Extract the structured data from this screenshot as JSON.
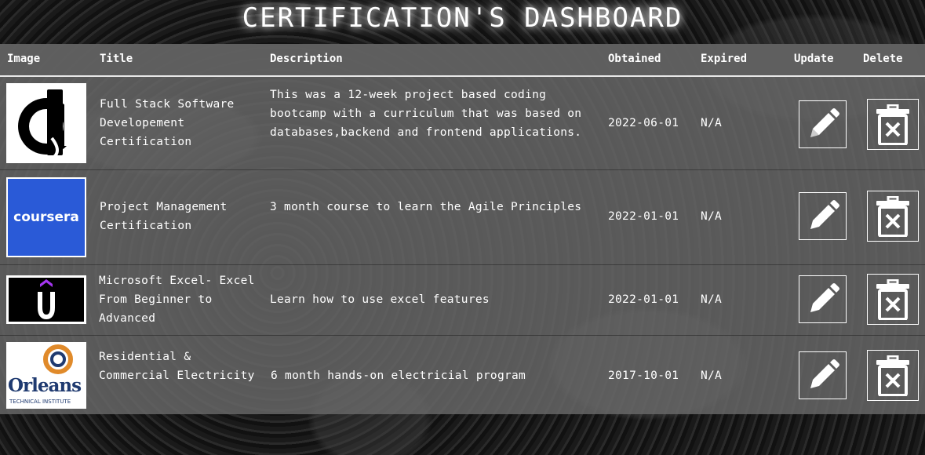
{
  "page": {
    "title": "CERTIFICATION'S DASHBOARD"
  },
  "table": {
    "headers": {
      "image": "Image",
      "title": "Title",
      "description": "Description",
      "obtained": "Obtained",
      "expired": "Expired",
      "update": "Update",
      "delete": "Delete"
    },
    "rows": [
      {
        "logo": "devmountain-logo",
        "title": "Full Stack Software Developement Certification",
        "description": "This was a 12-week project based coding bootcamp with a curriculum that was based on databases,backend and frontend applications.",
        "obtained": "2022-06-01",
        "expired": "N/A"
      },
      {
        "logo": "coursera-logo",
        "logo_text": "coursera",
        "title": "Project Management Certification",
        "description": "3 month course to learn the Agile Principles",
        "obtained": "2022-01-01",
        "expired": "N/A"
      },
      {
        "logo": "udemy-logo",
        "title": "Microsoft Excel- Excel From Beginner to Advanced",
        "description": "Learn how to use excel features",
        "obtained": "2022-01-01",
        "expired": "N/A"
      },
      {
        "logo": "orleans-logo",
        "logo_text": "Orleans",
        "logo_subtext": "TECHNICAL INSTITUTE",
        "title": "Residential & Commercial Electricity",
        "description": "6 month hands-on electricial program",
        "obtained": "2017-10-01",
        "expired": "N/A"
      }
    ]
  },
  "colors": {
    "coursera_blue": "#2a5ad7",
    "orleans_navy": "#1f3a70",
    "orleans_orange": "#e08a2a"
  }
}
